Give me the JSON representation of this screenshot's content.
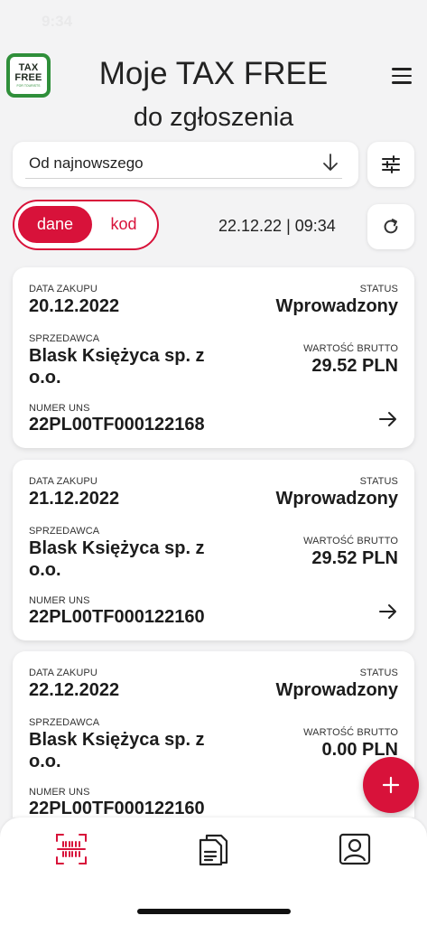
{
  "status_bar": {
    "time": "9:34"
  },
  "logo": {
    "line1": "TAX",
    "line2": "FREE",
    "line3": "FOR TOURISTS"
  },
  "header": {
    "title": "Moje TAX FREE",
    "subtitle": "do zgłoszenia"
  },
  "sort": {
    "selected": "Od najnowszego"
  },
  "toggle": {
    "active": "dane",
    "inactive": "kod"
  },
  "refresh": {
    "timestamp": "22.12.22 | 09:34"
  },
  "labels": {
    "date": "DATA ZAKUPU",
    "status": "STATUS",
    "seller": "SPRZEDAWCA",
    "gross": "WARTOŚĆ BRUTTO",
    "uns": "NUMER UNS"
  },
  "cards": [
    {
      "date": "20.12.2022",
      "status": "Wprowadzony",
      "seller": "Blask Księżyca sp. z o.o.",
      "gross": "29.52 PLN",
      "uns": "22PL00TF000122168"
    },
    {
      "date": "21.12.2022",
      "status": "Wprowadzony",
      "seller": "Blask Księżyca sp. z o.o.",
      "gross": "29.52 PLN",
      "uns": "22PL00TF000122160"
    },
    {
      "date": "22.12.2022",
      "status": "Wprowadzony",
      "seller": "Blask Księżyca sp. z o.o.",
      "gross": "0.00 PLN",
      "uns": "22PL00TF000122160"
    }
  ],
  "colors": {
    "accent": "#d8123a",
    "brand_green": "#2f8f3a",
    "background": "#f3f3f4"
  },
  "icons": {
    "menu": "hamburger-icon",
    "sort": "arrow-down-icon",
    "filter": "sliders-icon",
    "refresh": "refresh-icon",
    "card_arrow": "arrow-right-icon",
    "fab": "plus-icon",
    "nav": [
      "barcode-scan-icon",
      "documents-icon",
      "profile-icon"
    ]
  }
}
